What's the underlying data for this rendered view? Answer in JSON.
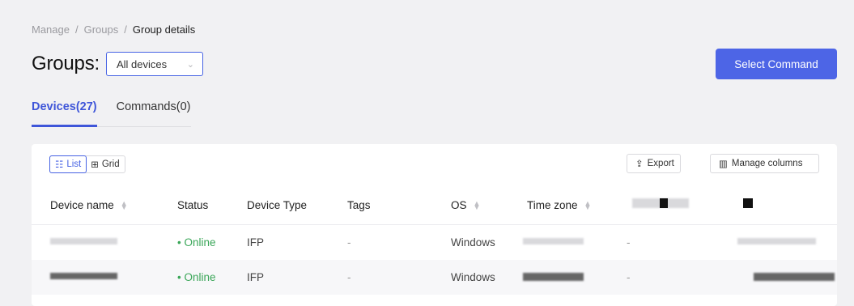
{
  "breadcrumb": [
    "Manage",
    "Groups",
    "Group details"
  ],
  "page_title": "Groups:",
  "group_select": {
    "value": "All devices"
  },
  "primary_action": "Select Command",
  "tabs": [
    {
      "label": "Devices(27)",
      "active": true
    },
    {
      "label": "Commands(0)",
      "active": false
    }
  ],
  "view_toggle": {
    "list": "List",
    "grid": "Grid"
  },
  "toolbar": {
    "export": "Export",
    "manage_columns": "Manage columns"
  },
  "columns": [
    "Device name",
    "Status",
    "Device Type",
    "Tags",
    "OS",
    "Time zone"
  ],
  "rows": [
    {
      "status": "• Online",
      "type": "IFP",
      "tags": "-",
      "os": "Windows",
      "extra": "-"
    },
    {
      "status": "• Online",
      "type": "IFP",
      "tags": "-",
      "os": "Windows",
      "extra": "-"
    }
  ],
  "colors": {
    "accent": "#4d65e6",
    "online": "#3aa658"
  },
  "icons": {
    "list": "list-icon",
    "grid": "grid-icon",
    "export": "export-icon",
    "columns": "columns-icon",
    "sort": "sort-icon",
    "dropdown": "chevron-down-icon"
  }
}
